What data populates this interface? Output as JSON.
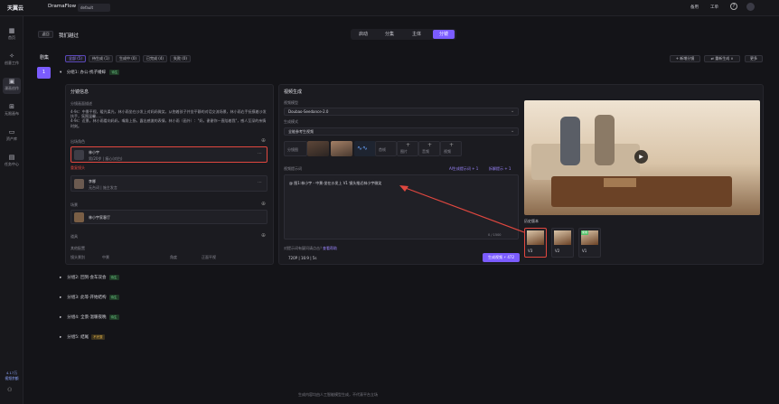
{
  "app": {
    "logo_text": "天翼云",
    "name": "DramaFlow",
    "env": "default",
    "header_right": [
      "备用",
      "工单"
    ]
  },
  "sidebar": {
    "items": [
      {
        "label": "首页",
        "icon": "grid-icon"
      },
      {
        "label": "创意工作",
        "icon": "sparkle-icon"
      },
      {
        "label": "漫画创作",
        "icon": "film-icon"
      },
      {
        "label": "无限画布",
        "icon": "canvas-icon"
      },
      {
        "label": "资产库",
        "icon": "folder-icon"
      },
      {
        "label": "任务中心",
        "icon": "calendar-icon"
      }
    ],
    "bottom": "4.17万\n视频余额"
  },
  "page": {
    "back": "返回",
    "title": "我们越过",
    "steps": [
      "启动",
      "分集",
      "主体",
      "分镜"
    ],
    "active_step": "分镜"
  },
  "episodes": {
    "title": "剧集",
    "current": "1"
  },
  "filters": [
    "全部 (5)",
    "待生成 (1)",
    "生成中 (0)",
    "已完成 (4)",
    "失败 (0)"
  ],
  "actions": [
    "+ 新增分镜",
    "⇄ 重新生成 ∨",
    "更多"
  ],
  "groups": [
    {
      "title": "分组1: 办公·找子婚嫁",
      "badge": "待生"
    },
    {
      "title": "分组2: 回到·会车双会",
      "badge": "待生"
    },
    {
      "title": "分组3: 此等·开始结构",
      "badge": "待生"
    },
    {
      "title": "分组4: 全景·温暖夜晚",
      "badge": "待生"
    },
    {
      "title": "分组5: 结尾",
      "badge": "不完整"
    }
  ],
  "storyboard": {
    "title": "分镜信息",
    "desc_label": "分镜画面描述",
    "desc": "4-9s：中景平视，暖光柔光，林小雨坐在沙发上对妈妈微笑，从抱着孩子并坐平静的对话交流场景，林小雨右手抚摸着沙发扶手，氛围温馨......\n4-9s：近景，林小雨看向妈妈，嘴角上扬，露出感激的表情，林小雨（画外）：\"妈，谢谢你一直陪着我\"，感人至深的亲情时刻。",
    "char_label": "出场角色",
    "chars": [
      {
        "name": "林小宇",
        "meta": "男/20岁  |  瘦心(对白)"
      },
      {
        "name": "李娜",
        "meta": "无台词  |  施主发言"
      }
    ],
    "char_note": "重复镜头",
    "scene_label": "场景",
    "scene": "林小宇家客厅",
    "prop_label": "道具",
    "cfg_label": "其他配置",
    "cfg": [
      [
        "镜头景别",
        "中景",
        "角度",
        "正面平视"
      ],
      [
        "运镜",
        "轻推",
        "光线",
        "自然光"
      ]
    ]
  },
  "video": {
    "title": "视频生成",
    "model_label": "视频模型",
    "model": "Doubao-Seedance-2.0",
    "mode_label": "生成模式",
    "mode": "全能参考生视频",
    "refs": [
      "分镜图",
      "背景音",
      "首帧",
      "图片",
      "音频",
      "视频"
    ],
    "prompt_label": "视频提示词",
    "prompt_links": [
      "AI生成提示词 + 1",
      "拆解提示 + 1"
    ],
    "prompt": "@ 图1:林小宇 - 中景·坐在沙发上 V1    镜头推近林小宇微笑",
    "counter": "0 / 1500",
    "hint": "对提示词有疑问请点击？",
    "hint_link": "查看帮助",
    "ratio": "720P | 16:9 | 5s",
    "gen": "生成视频 ⚡ 472"
  },
  "history": {
    "label": "历史版本",
    "items": [
      {
        "tag": "V3",
        "sel": true
      },
      {
        "tag": "V2",
        "sel": false
      },
      {
        "tag": "V1",
        "sel": false,
        "badge": "使用"
      }
    ]
  },
  "footer": "生成内容均由人工智能模型生成，不代表平台立场",
  "colors": {
    "accent": "#7b5cff",
    "danger": "#e0473f",
    "success": "#53c26a"
  }
}
